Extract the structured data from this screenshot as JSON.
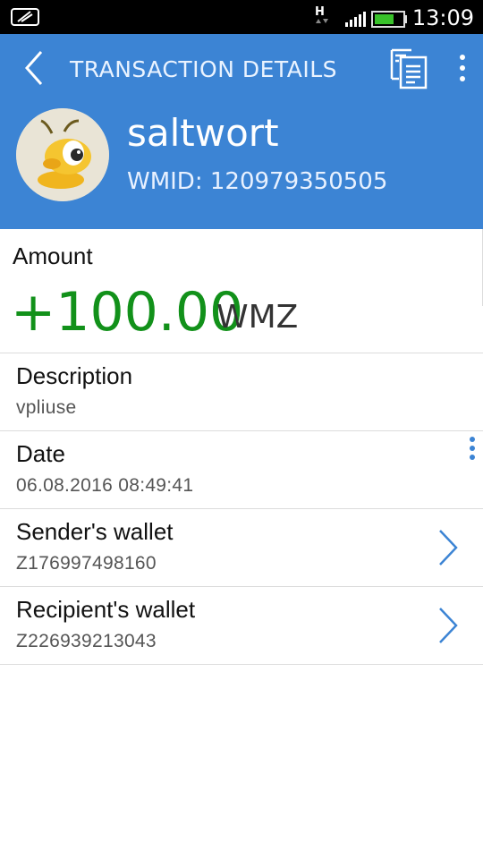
{
  "status_bar": {
    "time": "13:09",
    "network_type": "H",
    "battery_level": 0.7,
    "icons": [
      "signal-icon",
      "battery-icon",
      "network-activity-icon",
      "app-notification-icon"
    ]
  },
  "header": {
    "title": "TRANSACTION DETAILS",
    "user_name": "saltwort",
    "wmid": "WMID: 120979350505",
    "accent_color": "#3c84d4"
  },
  "amount": {
    "label": "Amount",
    "value": "+100.00",
    "currency": "WMZ",
    "value_color": "#12911a"
  },
  "rows": [
    {
      "label": "Description",
      "value": "vpliuse"
    },
    {
      "label": "Date",
      "value": "06.08.2016 08:49:41"
    },
    {
      "label": "Sender's wallet",
      "value": "Z176997498160"
    },
    {
      "label": "Recipient's wallet",
      "value": "Z226939213043"
    }
  ]
}
